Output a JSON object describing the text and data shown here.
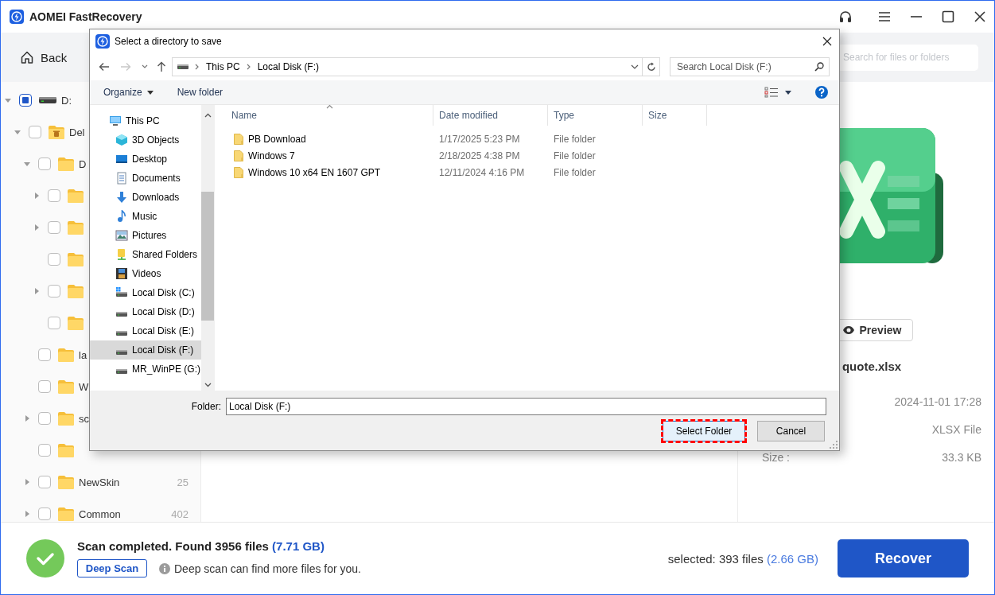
{
  "app": {
    "title": "AOMEI FastRecovery"
  },
  "toolbar": {
    "back": "Back",
    "search_placeholder": "Search for files or folders"
  },
  "tree": [
    {
      "label": "D:",
      "kind": "drive",
      "checked": false,
      "partial": true,
      "expanded": true,
      "children": [
        {
          "label": "Del",
          "kind": "recycle",
          "checked": false,
          "partial": false,
          "expanded": true,
          "children": [
            {
              "label": "D",
              "kind": "folder",
              "checked": false,
              "partial": false,
              "expanded": true,
              "children": [
                {
                  "kind": "folder",
                  "checked": false,
                  "partial": false,
                  "expanded": false
                },
                {
                  "kind": "folder",
                  "checked": false,
                  "partial": false,
                  "expanded": false
                },
                {
                  "kind": "folder",
                  "checked": false,
                  "partial": false
                },
                {
                  "kind": "folder",
                  "checked": false,
                  "partial": false,
                  "expanded": false
                },
                {
                  "kind": "folder",
                  "checked": false,
                  "partial": false
                }
              ]
            },
            {
              "label": "la",
              "kind": "folder",
              "checked": false,
              "partial": false
            },
            {
              "label": "W",
              "kind": "folder",
              "checked": false,
              "partial": false
            },
            {
              "label": "sc",
              "kind": "folder",
              "checked": false,
              "partial": false,
              "expanded": false
            },
            {
              "kind": "folder",
              "checked": false,
              "partial": false
            },
            {
              "label": "NewSkin",
              "kind": "folder",
              "checked": false,
              "partial": false,
              "expanded": false,
              "count": "25"
            },
            {
              "label": "Common",
              "kind": "folder",
              "checked": false,
              "partial": false,
              "expanded": false,
              "count": "402"
            }
          ]
        }
      ]
    }
  ],
  "details": {
    "preview": "Preview",
    "file_name": "quote.xlsx",
    "rows": [
      {
        "value": "2024-11-01 17:28"
      },
      {
        "value": "XLSX File"
      },
      {
        "label": "Size :",
        "value": "33.3 KB"
      }
    ]
  },
  "status_bar": {
    "title": "Scan completed. Found 3956 files",
    "title_size": "(7.71 GB)",
    "deep_scan": "Deep Scan",
    "hint": "Deep scan can find more files for you.",
    "selected": "selected: 393 files",
    "selected_size": "(2.66 GB)",
    "recover": "Recover"
  },
  "dialog": {
    "title": "Select a directory to save",
    "history": [
      {
        "kind": "back",
        "disabled": false
      },
      {
        "kind": "forward",
        "disabled": true
      }
    ],
    "address": [
      "This PC",
      "Local Disk (F:)"
    ],
    "search_placeholder": "Search Local Disk (F:)",
    "commands": [
      {
        "label": "Organize",
        "menu": true
      },
      {
        "label": "New folder",
        "menu": false
      }
    ],
    "nav_pane": [
      {
        "label": "This PC",
        "kind": "pc",
        "selected": false
      },
      {
        "label": "3D Objects",
        "kind": "objects",
        "selected": false
      },
      {
        "label": "Desktop",
        "kind": "desktop",
        "selected": false
      },
      {
        "label": "Documents",
        "kind": "documents",
        "selected": false
      },
      {
        "label": "Downloads",
        "kind": "downloads",
        "selected": false
      },
      {
        "label": "Music",
        "kind": "music",
        "selected": false
      },
      {
        "label": "Pictures",
        "kind": "pictures",
        "selected": false
      },
      {
        "label": "Shared Folders",
        "kind": "shared",
        "selected": false
      },
      {
        "label": "Videos",
        "kind": "videos",
        "selected": false
      },
      {
        "label": "Local Disk (C:)",
        "kind": "system-drive",
        "selected": false
      },
      {
        "label": "Local Disk (D:)",
        "kind": "drive",
        "selected": false
      },
      {
        "label": "Local Disk (E:)",
        "kind": "drive",
        "selected": false
      },
      {
        "label": "Local Disk (F:)",
        "kind": "drive",
        "selected": true
      },
      {
        "label": "MR_WinPE (G:)",
        "kind": "drive",
        "selected": false
      }
    ],
    "columns": [
      {
        "label": "Name",
        "sorted": true
      },
      {
        "label": "Date modified",
        "sorted": false
      },
      {
        "label": "Type",
        "sorted": false
      },
      {
        "label": "Size",
        "sorted": false
      }
    ],
    "files": [
      {
        "name": "PB Download",
        "date": "1/17/2025 5:23 PM",
        "type": "File folder",
        "selected": false
      },
      {
        "name": "Windows 7",
        "date": "2/18/2025 4:38 PM",
        "type": "File folder",
        "selected": false
      },
      {
        "name": "Windows 10 x64 EN 1607 GPT",
        "date": "12/11/2024 4:16 PM",
        "type": "File folder",
        "selected": false
      }
    ],
    "folder_label": "Folder:",
    "folder_value": "Local Disk (F:)",
    "buttons": [
      {
        "label": "Select Folder",
        "highlighted": true
      },
      {
        "label": "Cancel",
        "highlighted": false
      }
    ]
  }
}
